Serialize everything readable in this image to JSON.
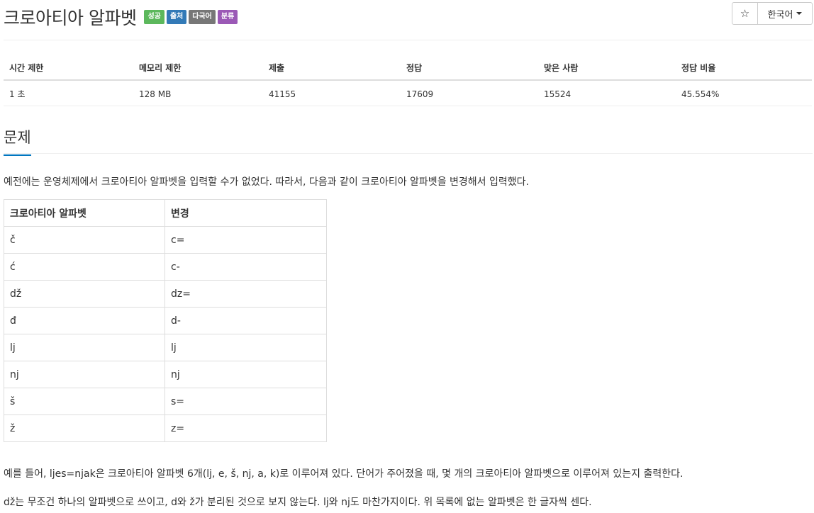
{
  "problem": {
    "title": "크로아티아 알파벳",
    "labels": [
      {
        "text": "성공",
        "color": "#5cb85c"
      },
      {
        "text": "출처",
        "color": "#337ab7"
      },
      {
        "text": "다국어",
        "color": "#777777"
      },
      {
        "text": "분류",
        "color": "#9b59b6"
      }
    ]
  },
  "controls": {
    "star_glyph": "☆",
    "language": "한국어"
  },
  "stats": {
    "headers": [
      "시간 제한",
      "메모리 제한",
      "제출",
      "정답",
      "맞은 사람",
      "정답 비율"
    ],
    "values": [
      "1 초",
      "128 MB",
      "41155",
      "17609",
      "15524",
      "45.554%"
    ]
  },
  "section": {
    "heading": "문제"
  },
  "description": {
    "intro": "예전에는 운영체제에서 크로아티아 알파벳을 입력할 수가 없었다. 따라서, 다음과 같이 크로아티아 알파벳을 변경해서 입력했다.",
    "example": "예를 들어, ljes=njak은 크로아티아 알파벳 6개(lj, e, š, nj, a, k)로 이루어져 있다. 단어가 주어졌을 때, 몇 개의 크로아티아 알파벳으로 이루어져 있는지 출력한다.",
    "note": "dž는 무조건 하나의 알파벳으로 쓰이고, d와 ž가 분리된 것으로 보지 않는다. lj와 nj도 마찬가지이다. 위 목록에 없는 알파벳은 한 글자씩 센다."
  },
  "alphabet_table": {
    "headers": [
      "크로아티아 알파벳",
      "변경"
    ],
    "rows": [
      [
        "č",
        "c="
      ],
      [
        "ć",
        "c-"
      ],
      [
        "dž",
        "dz="
      ],
      [
        "đ",
        "d-"
      ],
      [
        "lj",
        "lj"
      ],
      [
        "nj",
        "nj"
      ],
      [
        "š",
        "s="
      ],
      [
        "ž",
        "z="
      ]
    ]
  }
}
